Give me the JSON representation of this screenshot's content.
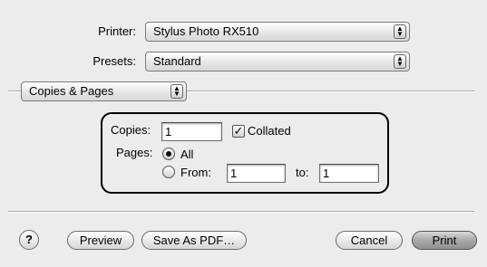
{
  "printer": {
    "label": "Printer:",
    "value": "Stylus Photo RX510"
  },
  "presets": {
    "label": "Presets:",
    "value": "Standard"
  },
  "panel": {
    "value": "Copies & Pages"
  },
  "copies": {
    "label": "Copies:",
    "value": "1",
    "collated_label": "Collated",
    "collated": true
  },
  "pages": {
    "label": "Pages:",
    "all_label": "All",
    "from_label": "From:",
    "from_value": "1",
    "to_label": "to:",
    "to_value": "1",
    "selected": "All"
  },
  "buttons": {
    "help": "?",
    "preview": "Preview",
    "save_pdf": "Save As PDF…",
    "cancel": "Cancel",
    "print": "Print"
  },
  "icons": {
    "popup_arrows": "up-down-arrows-icon",
    "checkmark": "checkmark-icon",
    "help": "question-mark-icon"
  }
}
